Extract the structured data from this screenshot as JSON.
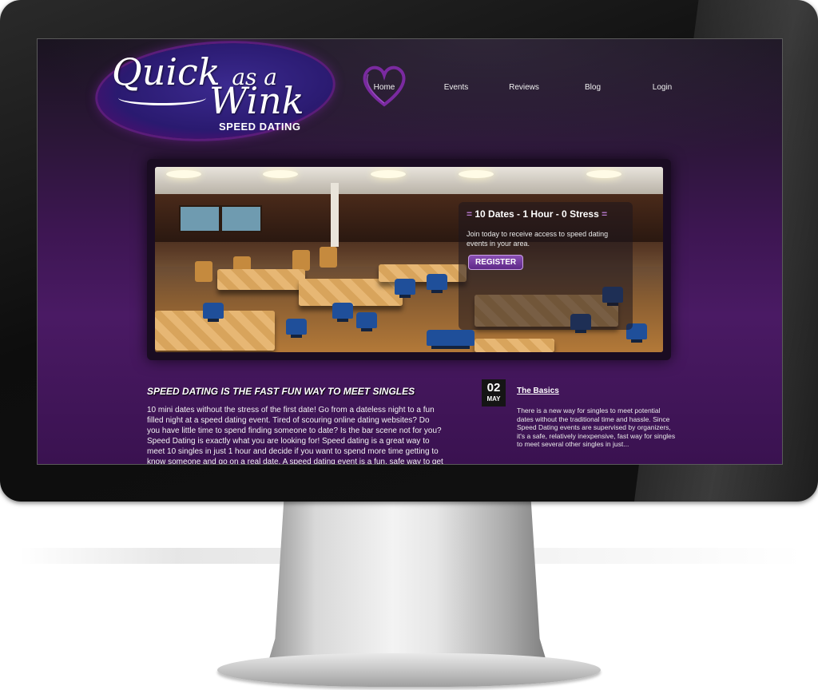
{
  "site": {
    "logo": {
      "line1_main": "Quick",
      "line1_small": "as a",
      "line2": "Wink",
      "subtitle": "SPEED DATING"
    },
    "nav": {
      "items": [
        "Home",
        "Events",
        "Reviews",
        "Blog",
        "Login"
      ],
      "active": "Home"
    },
    "hero": {
      "title_dash_left": "=",
      "title": "10 Dates - 1 Hour - 0 Stress",
      "title_dash_right": "=",
      "text": "Join today to receive access to speed dating events in your area.",
      "button": "REGISTER"
    },
    "main": {
      "heading": "SPEED DATING IS THE FAST FUN WAY TO MEET SINGLES",
      "body": "10 mini dates without the stress of the first date! Go from a dateless night to a fun filled night at a speed dating event. Tired of scouring online dating websites? Do you have little time to spend finding someone to date? Is the bar scene not for you? Speed Dating is exactly what you are looking for! Speed dating is a great way to meet 10 singles in just 1 hour and decide if you want to spend more time getting to know someone and go on a real date. A speed dating event is a fun, safe way to get"
    },
    "post": {
      "day": "02",
      "month": "MAY",
      "title": "The Basics",
      "excerpt": "There is a new way for singles to meet potential dates without the traditional time and hassle. Since Speed Dating events are supervised by organizers, it's a safe, relatively inexpensive, fast way for singles to meet several other singles in just..."
    }
  },
  "colors": {
    "brand_purple": "#4a1a64",
    "button_purple": "#7a3ea6",
    "heart": "#7a2aa0"
  }
}
